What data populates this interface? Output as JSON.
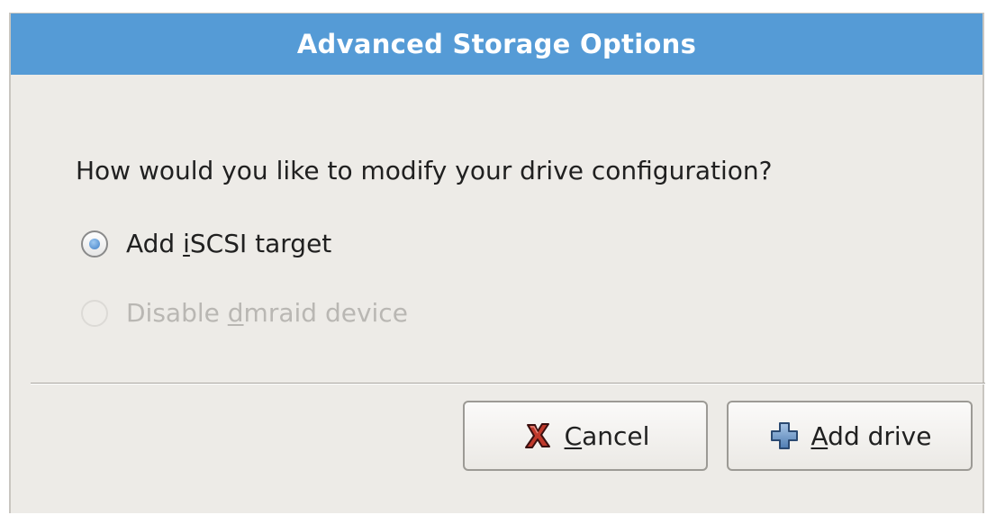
{
  "dialog": {
    "title": "Advanced Storage Options",
    "question": "How would you like to modify your drive configuration?",
    "options": [
      {
        "pre": "Add ",
        "accel": "i",
        "post": "SCSI target",
        "selected": true,
        "enabled": true
      },
      {
        "pre": "Disable ",
        "accel": "d",
        "post": "mraid device",
        "selected": false,
        "enabled": false
      }
    ],
    "buttons": {
      "cancel": {
        "accel": "C",
        "rest": "ancel",
        "icon": "x-cancel-icon"
      },
      "add": {
        "accel": "A",
        "rest": "dd drive",
        "icon": "plus-add-icon"
      }
    }
  },
  "colors": {
    "titlebar": "#559bd6",
    "dialog_bg": "#edebe7",
    "disabled_text": "#b9b7b3"
  }
}
